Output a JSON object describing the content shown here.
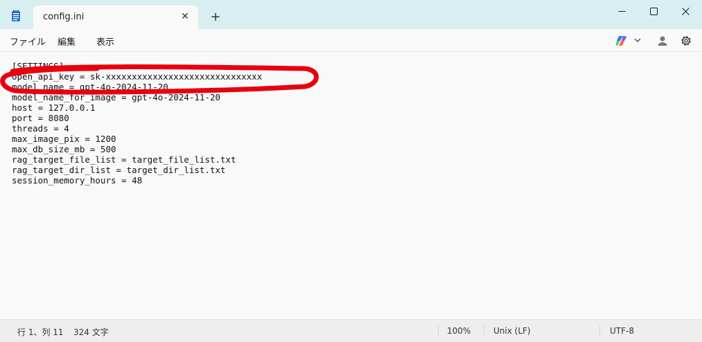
{
  "window": {
    "tab_title": "config.ini",
    "new_tab_symbol": "+",
    "close_tab_symbol": "✕"
  },
  "menu": {
    "file": "ファイル",
    "edit": "編集",
    "view": "表示"
  },
  "editor": {
    "lines": [
      "[SETTINGS]",
      "open_api_key = sk-xxxxxxxxxxxxxxxxxxxxxxxxxxxxxx",
      "model_name = gpt-4o-2024-11-20",
      "model_name_for_image = gpt-4o-2024-11-20",
      "host = 127.0.0.1",
      "port = 8080",
      "threads = 4",
      "max_image_pix = 1200",
      "max_db_size_mb = 500",
      "rag_target_file_list = target_file_list.txt",
      "rag_target_dir_list = target_dir_list.txt",
      "session_memory_hours = 48"
    ],
    "annotation_color": "#e8000f"
  },
  "status": {
    "position": "行 1、列 11",
    "char_count": "324 文字",
    "zoom": "100%",
    "line_ending": "Unix (LF)",
    "encoding": "UTF-8"
  },
  "icons": {
    "app": "notepad-icon",
    "copilot": "copilot-icon",
    "account": "account-icon",
    "settings": "gear-icon"
  }
}
